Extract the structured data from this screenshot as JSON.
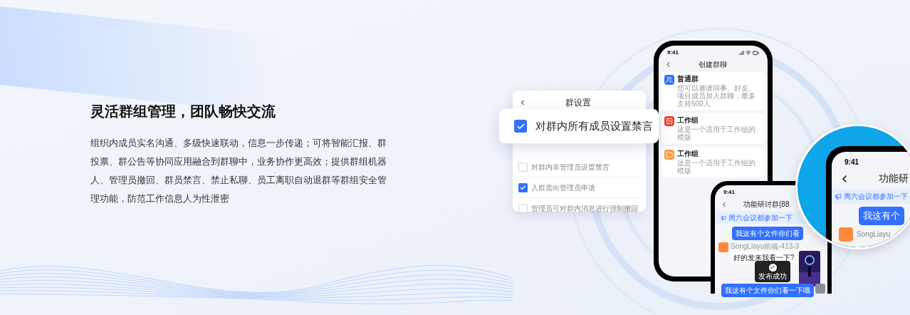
{
  "heading": "灵活群组管理，团队畅快交流",
  "description": "组织内成员实名沟通、多级快速联动，信息一步传递；可将智能汇报、群投票、群公告等协同应用融合到群聊中，业务协作更高效；提供群组机器人、管理员撤回、群员禁言、禁止私聊、员工离职自动退群等群组安全管理功能，防范工作信息人为性泄密",
  "settings_card": {
    "title": "群设置",
    "popup": {
      "label": "对群内所有成员设置禁言",
      "checked": true
    },
    "options": [
      {
        "label": "对群内非管理员设置禁言",
        "checked": false
      },
      {
        "label": "入群需向管理员申请",
        "checked": true
      },
      {
        "label": "管理员可对群内消息进行强制撤回",
        "checked": false
      }
    ]
  },
  "create_phone": {
    "time": "9:41",
    "title": "创建群聊",
    "items": [
      {
        "title": "普通群",
        "desc": "您可以邀请同事、好友、项目成员加入群聊，最多支持500人",
        "color": "#2f6bff"
      },
      {
        "title": "工作组",
        "desc": "这是一个适用于工作组的模版",
        "color": "#f5381f"
      },
      {
        "title": "工作组",
        "desc": "这是一个适用于工作组的模版",
        "color": "#ff9a3d"
      }
    ]
  },
  "chat_phone": {
    "time": "9:41",
    "title": "功能研讨群(88",
    "announcement": "周六会议都参加一下",
    "sent": "我这有个文件你们看",
    "sender": "SongLiayu前端-413-3",
    "reply": "好的发来我看一下?",
    "sent_2": "我这有个文件你们看一下哦",
    "toast": "发布成功"
  },
  "magnifier": {
    "time": "9:41",
    "title": "功能研",
    "announcement": "周六会议都参加一下",
    "sent": "我这有个",
    "sender": "SongLiayu"
  }
}
